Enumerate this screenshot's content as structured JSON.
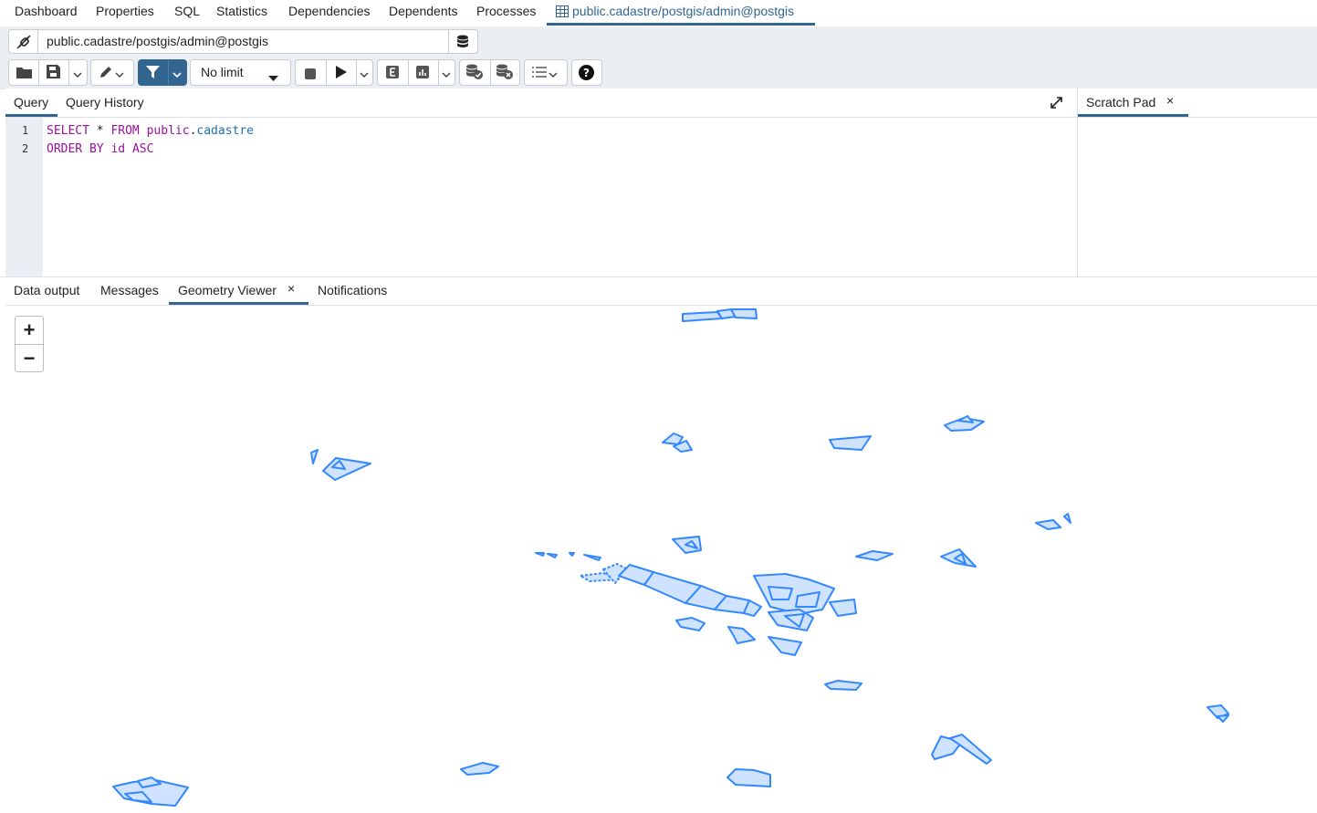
{
  "top_tabs": {
    "dashboard": "Dashboard",
    "properties": "Properties",
    "sql": "SQL",
    "statistics": "Statistics",
    "dependencies": "Dependencies",
    "dependents": "Dependents",
    "processes": "Processes",
    "query_tool": "public.cadastre/postgis/admin@postgis"
  },
  "connection": {
    "label": "public.cadastre/postgis/admin@postgis"
  },
  "toolbar": {
    "limit_value": "No limit"
  },
  "editor": {
    "tabs": {
      "query": "Query",
      "history": "Query History"
    },
    "scratch_pad": "Scratch Pad",
    "close_glyph": "×",
    "lines": [
      {
        "number": "1",
        "tokens": [
          "SELECT",
          " * ",
          "FROM",
          " ",
          "public",
          ".",
          "cadastre"
        ]
      },
      {
        "number": "2",
        "tokens": [
          "ORDER BY",
          " ",
          "id",
          " ",
          "ASC"
        ]
      }
    ]
  },
  "results": {
    "tabs": {
      "data_output": "Data output",
      "messages": "Messages",
      "geometry_viewer": "Geometry Viewer",
      "notifications": "Notifications"
    },
    "close_glyph": "×"
  },
  "map": {
    "zoom_in": "+",
    "zoom_out": "−",
    "feature_stroke": "#3388ff",
    "feature_fill": "#cfe3ff"
  },
  "colors": {
    "accent": "#326690",
    "toolbar_bg": "#ebeef3"
  }
}
